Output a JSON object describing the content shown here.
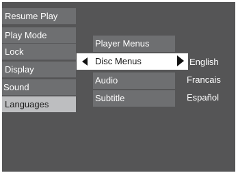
{
  "main_menu": {
    "items": [
      {
        "label": "Resume Play"
      },
      {
        "label": "Play Mode"
      },
      {
        "label": "Lock"
      },
      {
        "label": "Display"
      },
      {
        "label": "Sound"
      },
      {
        "label": "Languages"
      }
    ],
    "selected": "Languages"
  },
  "sub_menu": {
    "items": [
      {
        "label": "Player Menus"
      },
      {
        "label": "Disc Menus"
      },
      {
        "label": "Audio"
      },
      {
        "label": "Subtitle"
      }
    ],
    "selected": "Disc Menus",
    "left_arrow_icon": "triangle-left-icon",
    "right_arrow_icon": "triangle-right-icon"
  },
  "options": {
    "items": [
      {
        "label": "English"
      },
      {
        "label": "Francais"
      },
      {
        "label": "Español"
      }
    ]
  },
  "colors": {
    "background": "#555556",
    "item": "#6e6f71",
    "selected_main": "#bdbec0",
    "selected_sub": "#ffffff",
    "text": "#ffffff"
  }
}
